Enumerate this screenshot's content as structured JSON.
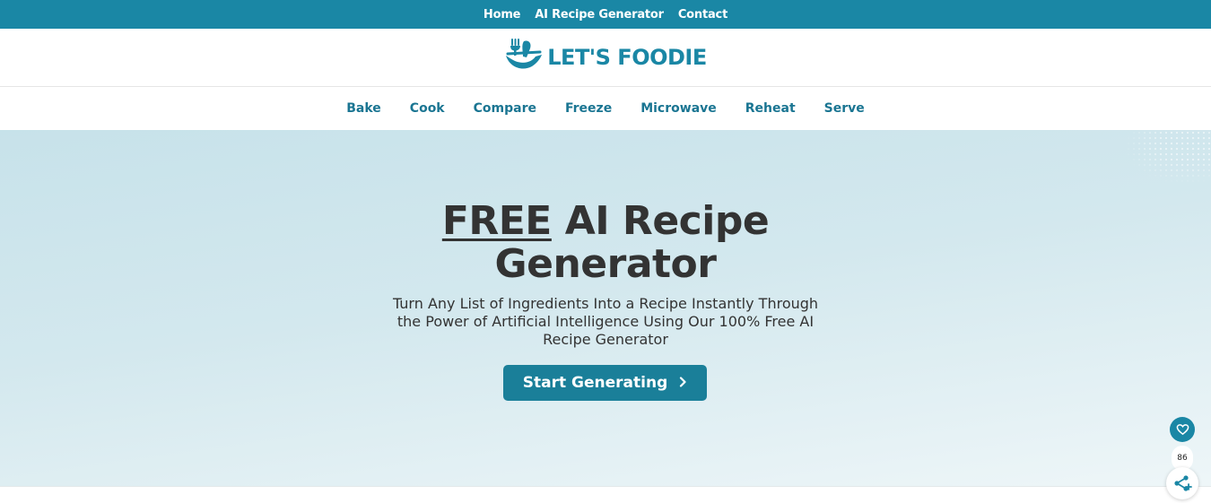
{
  "top_nav": {
    "items": [
      "Home",
      "AI Recipe Generator",
      "Contact"
    ]
  },
  "brand": {
    "name": "LET'S FOODIE",
    "color": "#1a87a5"
  },
  "category_nav": {
    "items": [
      "Bake",
      "Cook",
      "Compare",
      "Freeze",
      "Microwave",
      "Reheat",
      "Serve"
    ]
  },
  "hero": {
    "title_highlight": "FREE",
    "title_rest": " AI Recipe Generator",
    "subtitle": "Turn Any List of Ingredients Into a Recipe Instantly Through the Power of Artificial Intelligence Using Our 100% Free AI Recipe Generator",
    "cta_label": "Start Generating",
    "cta_icon": "chevron-right-icon"
  },
  "share_widget": {
    "favorite_icon": "heart-icon",
    "count": "86",
    "share_icon": "share-icon"
  },
  "colors": {
    "primary": "#1a87a5",
    "button": "#1a7f99",
    "text": "#333333"
  }
}
